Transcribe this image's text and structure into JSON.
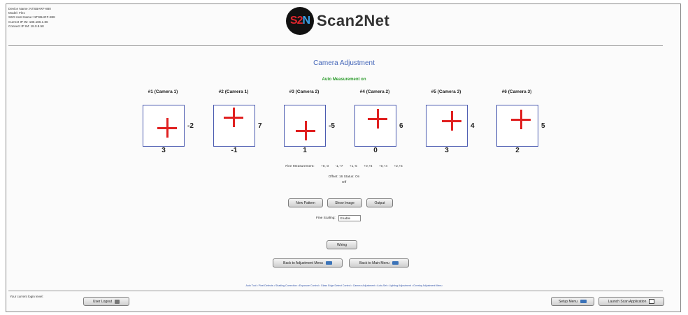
{
  "device_info": {
    "lines": [
      "Device Name: NTSBARF-880",
      "Model: Flex",
      "S6O Host Name: NTSBARF-888",
      "Current IP IM: 186.186.1.86",
      "Connect IP IM: 18.0.8.58"
    ]
  },
  "logo": {
    "mark_left": "S2",
    "mark_right": "N",
    "text": "Scan2Net"
  },
  "page_title": "Camera Adjustment",
  "auto_measurement": "Auto Measurement on",
  "cameras": [
    {
      "label": "#1 (Camera 1)",
      "side_value": "-2",
      "bottom_value": "3"
    },
    {
      "label": "#2 (Camera 1)",
      "side_value": "7",
      "bottom_value": "-1"
    },
    {
      "label": "#3 (Camera 2)",
      "side_value": "-5",
      "bottom_value": "1"
    },
    {
      "label": "#4 (Camera 2)",
      "side_value": "6",
      "bottom_value": "0"
    },
    {
      "label": "#5 (Camera 3)",
      "side_value": "4",
      "bottom_value": "3"
    },
    {
      "label": "#6 (Camera 3)",
      "side_value": "5",
      "bottom_value": "2"
    }
  ],
  "fine_measurement": {
    "label": "Fine Measurement:",
    "values": [
      "+0,-3",
      "-1,+7",
      "+1,-5",
      "+0,+6",
      "+0,+4",
      "+2,+5"
    ]
  },
  "offset_line": "Offset: 16   Status: On",
  "off_label": "Off",
  "buttons": {
    "new_pattern": "New Pattern",
    "show_image": "Show Image",
    "output": "Output",
    "wiring": "Wiring",
    "back_adjustment": "Back to Adjustment Menu",
    "back_main": "Back to Main Menu",
    "user_logout": "User Logout",
    "setup_menu": "Setup Menu",
    "launch_scan": "Launch Scan Application"
  },
  "scaling": {
    "label": "Fine Scaling:",
    "value": "Enable"
  },
  "links": "Auto Tool • Pixel Defects • Shading Correction • Exposure Control • Glass Edge Detect Control • Camera Adjustment • Auto-Set • Lighting Adjustment • Overlap Adjustment Menu",
  "footer": {
    "message": "Your current login level:"
  }
}
